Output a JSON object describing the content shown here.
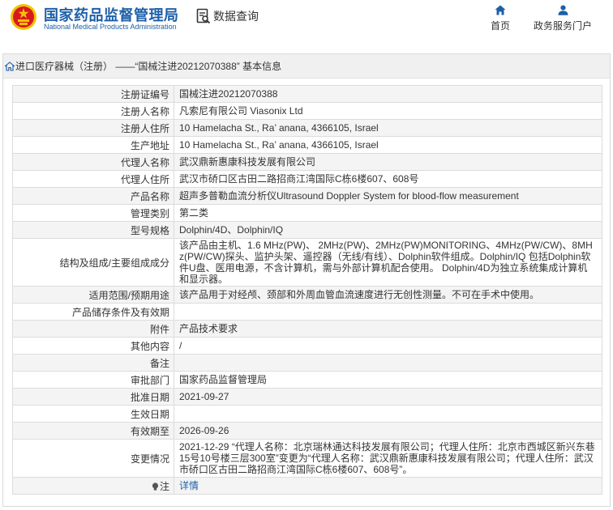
{
  "header": {
    "brand_cn": "国家药品监督管理局",
    "brand_en": "National Medical Products Administration",
    "query_label": "数据查询",
    "nav": [
      {
        "label": "首页",
        "icon": "home-icon"
      },
      {
        "label": "政务服务门户",
        "icon": "user-icon"
      }
    ]
  },
  "panel": {
    "title": "进口医疗器械（注册） ——“国械注进20212070388” 基本信息"
  },
  "fields": [
    {
      "label": "注册证编号",
      "value": "国械注进20212070388"
    },
    {
      "label": "注册人名称",
      "value": "凡索尼有限公司 Viasonix Ltd"
    },
    {
      "label": "注册人住所",
      "value": "10 Hamelacha St., Ra’ anana, 4366105, Israel"
    },
    {
      "label": "生产地址",
      "value": "10 Hamelacha St., Ra’ anana, 4366105, Israel"
    },
    {
      "label": "代理人名称",
      "value": "武汉鼎新惠康科技发展有限公司"
    },
    {
      "label": "代理人住所",
      "value": "武汉市硚口区古田二路招商江湾国际C栋6楼607、608号"
    },
    {
      "label": "产品名称",
      "value": "超声多普勒血流分析仪Ultrasound Doppler System for blood-flow measurement"
    },
    {
      "label": "管理类别",
      "value": "第二类"
    },
    {
      "label": "型号规格",
      "value": "Dolphin/4D、Dolphin/IQ"
    },
    {
      "label": "结构及组成/主要组成成分",
      "value": "该产品由主机、1.6 MHz(PW)、 2MHz(PW)、2MHz(PW)MONITORING、4MHz(PW/CW)、8MHz(PW/CW)探头、监护头架、遥控器（无线/有线）、Dolphin软件组成。Dolphin/IQ 包括Dolphin软件U盘、医用电源，不含计算机，需与外部计算机配合使用。 Dolphin/4D为独立系统集成计算机和显示器。"
    },
    {
      "label": "适用范围/预期用途",
      "value": "该产品用于对经颅、颈部和外周血管血流速度进行无创性测量。不可在手术中使用。"
    },
    {
      "label": "产品储存条件及有效期",
      "value": ""
    },
    {
      "label": "附件",
      "value": "产品技术要求"
    },
    {
      "label": "其他内容",
      "value": "/"
    },
    {
      "label": "备注",
      "value": ""
    },
    {
      "label": "审批部门",
      "value": "国家药品监督管理局"
    },
    {
      "label": "批准日期",
      "value": "2021-09-27"
    },
    {
      "label": "生效日期",
      "value": ""
    },
    {
      "label": "有效期至",
      "value": "2026-09-26"
    },
    {
      "label": "变更情况",
      "value": "2021-12-29 “代理人名称：北京瑞林通达科技发展有限公司；代理人住所：北京市西城区新兴东巷15号10号楼三层300室”变更为“代理人名称：武汉鼎新惠康科技发展有限公司；代理人住所：武汉市硚口区古田二路招商江湾国际C栋6楼607、608号”。"
    },
    {
      "label": "注",
      "value": "详情"
    }
  ],
  "colors": {
    "brand": "#1d5fa8",
    "emblem_red": "#d7191e",
    "emblem_gold": "#f2c200"
  }
}
